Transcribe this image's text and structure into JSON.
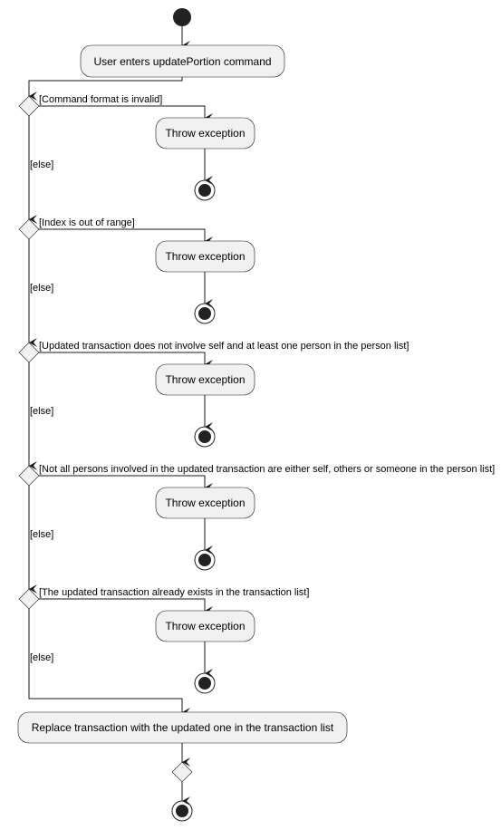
{
  "diagram": {
    "type": "activity",
    "start_activity": "User enters updatePortion command",
    "checks": [
      {
        "condition": "[Command format is invalid]",
        "action": "Throw exception",
        "else_label": "[else]"
      },
      {
        "condition": "[Index is out of range]",
        "action": "Throw exception",
        "else_label": "[else]"
      },
      {
        "condition": "[Updated transaction does not involve self and at least one person in the person list]",
        "action": "Throw exception",
        "else_label": "[else]"
      },
      {
        "condition": "[Not all persons involved in the updated transaction are either self, others or someone in the person list]",
        "action": "Throw exception",
        "else_label": "[else]"
      },
      {
        "condition": "[The updated transaction already exists in the transaction list]",
        "action": "Throw exception",
        "else_label": "[else]"
      }
    ],
    "final_activity": "Replace transaction with the updated one in the transaction list",
    "colors": {
      "node_fill": "#f1f1f1",
      "line": "#181818",
      "start_end": "#222222"
    }
  }
}
